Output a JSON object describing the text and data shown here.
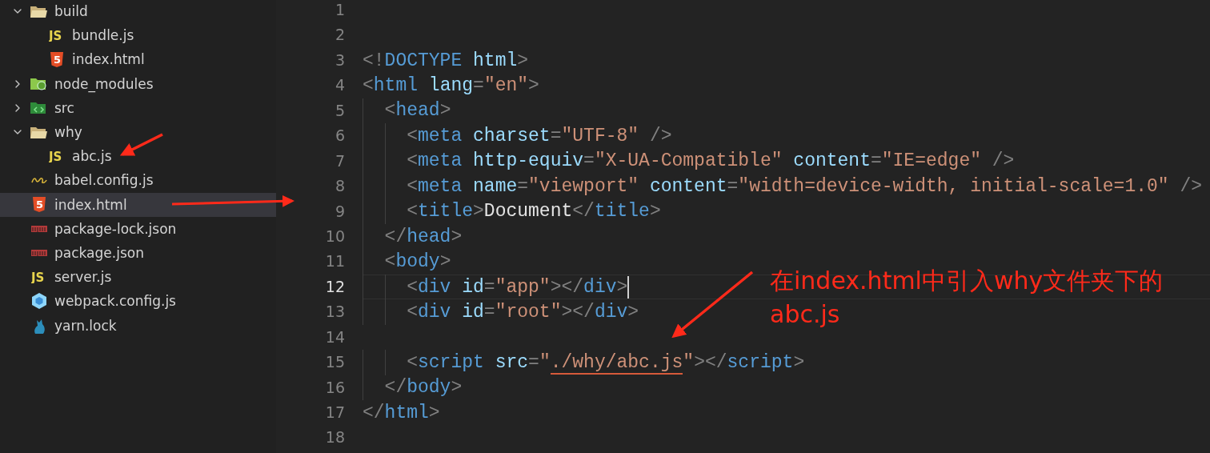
{
  "explorer": {
    "items": [
      {
        "kind": "folder",
        "name": "build",
        "expanded": true,
        "selected": false,
        "children": [
          {
            "kind": "js",
            "name": "bundle.js",
            "icon_label": "JS",
            "selected": false
          },
          {
            "kind": "html",
            "name": "index.html",
            "icon_label": "5",
            "selected": false
          }
        ]
      },
      {
        "kind": "node-folder",
        "name": "node_modules",
        "expanded": false,
        "selected": false
      },
      {
        "kind": "src-folder",
        "name": "src",
        "expanded": false,
        "selected": false
      },
      {
        "kind": "folder",
        "name": "why",
        "expanded": true,
        "selected": false,
        "children": [
          {
            "kind": "js",
            "name": "abc.js",
            "icon_label": "JS",
            "selected": false
          }
        ]
      },
      {
        "kind": "babel",
        "name": "babel.config.js",
        "selected": false
      },
      {
        "kind": "html",
        "name": "index.html",
        "icon_label": "5",
        "selected": true
      },
      {
        "kind": "npm",
        "name": "package-lock.json",
        "selected": false
      },
      {
        "kind": "npm",
        "name": "package.json",
        "selected": false
      },
      {
        "kind": "js",
        "name": "server.js",
        "icon_label": "JS",
        "selected": false
      },
      {
        "kind": "webpack",
        "name": "webpack.config.js",
        "selected": false
      },
      {
        "kind": "yarn",
        "name": "yarn.lock",
        "selected": false
      }
    ]
  },
  "editor": {
    "lines": [
      {
        "number": "1",
        "current": false
      },
      {
        "number": "2",
        "current": false
      },
      {
        "number": "3",
        "current": false,
        "code": "<!DOCTYPE html>"
      },
      {
        "number": "4",
        "current": false,
        "code": "<html lang=\"en\">"
      },
      {
        "number": "5",
        "current": false,
        "code": "  <head>"
      },
      {
        "number": "6",
        "current": false,
        "code": "    <meta charset=\"UTF-8\" />"
      },
      {
        "number": "7",
        "current": false,
        "code": "    <meta http-equiv=\"X-UA-Compatible\" content=\"IE=edge\" />"
      },
      {
        "number": "8",
        "current": false,
        "code": "    <meta name=\"viewport\" content=\"width=device-width, initial-scale=1.0\" />"
      },
      {
        "number": "9",
        "current": false,
        "code": "    <title>Document</title>"
      },
      {
        "number": "10",
        "current": false,
        "code": "  </head>"
      },
      {
        "number": "11",
        "current": false,
        "code": "  <body>"
      },
      {
        "number": "12",
        "current": true,
        "code": "    <div id=\"app\"></div>"
      },
      {
        "number": "13",
        "current": false,
        "code": "    <div id=\"root\"></div>"
      },
      {
        "number": "14",
        "current": false
      },
      {
        "number": "15",
        "current": false,
        "segments": [
          {
            "text": "    <script src=\""
          },
          {
            "text": "./why/abc.js",
            "underline": true
          },
          {
            "text": "\"></script>"
          }
        ]
      },
      {
        "number": "16",
        "current": false,
        "code": "  </body>"
      },
      {
        "number": "17",
        "current": false,
        "code": "</html>"
      },
      {
        "number": "18",
        "current": false
      }
    ]
  },
  "annotation": {
    "note": "在index.html中引入why文件夹下的abc.js"
  }
}
